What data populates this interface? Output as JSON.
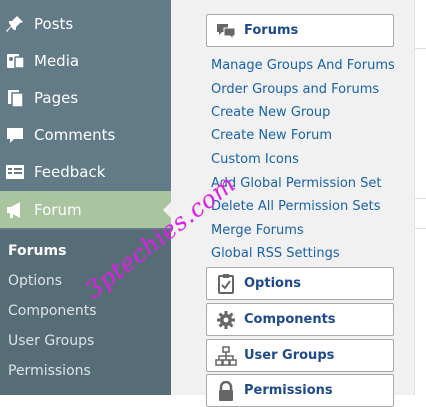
{
  "sidebar": {
    "items": [
      {
        "label": "Posts",
        "icon": "pin-icon"
      },
      {
        "label": "Media",
        "icon": "media-icon"
      },
      {
        "label": "Pages",
        "icon": "pages-icon"
      },
      {
        "label": "Comments",
        "icon": "comment-icon"
      },
      {
        "label": "Feedback",
        "icon": "feedback-icon"
      },
      {
        "label": "Forum",
        "icon": "megaphone-icon"
      }
    ],
    "submenu": [
      {
        "label": "Forums"
      },
      {
        "label": "Options"
      },
      {
        "label": "Components"
      },
      {
        "label": "User Groups"
      },
      {
        "label": "Permissions"
      }
    ]
  },
  "panel": {
    "forums_button": "Forums",
    "links": [
      "Manage Groups And Forums",
      "Order Groups and Forums",
      "Create New Group",
      "Create New Forum",
      "Custom Icons",
      "Add Global Permission Set",
      "Delete All Permission Sets",
      "Merge Forums",
      "Global RSS Settings"
    ],
    "buttons": [
      {
        "label": "Options",
        "icon": "clipboard-check-icon"
      },
      {
        "label": "Components",
        "icon": "gear-icon"
      },
      {
        "label": "User Groups",
        "icon": "hierarchy-icon"
      },
      {
        "label": "Permissions",
        "icon": "lock-icon"
      }
    ]
  },
  "watermark": "3ptechies.com",
  "colors": {
    "sidebar": "#637b86",
    "active": "#a8c5a0",
    "link": "#1a62a8",
    "watermark": "#e01ee8"
  }
}
